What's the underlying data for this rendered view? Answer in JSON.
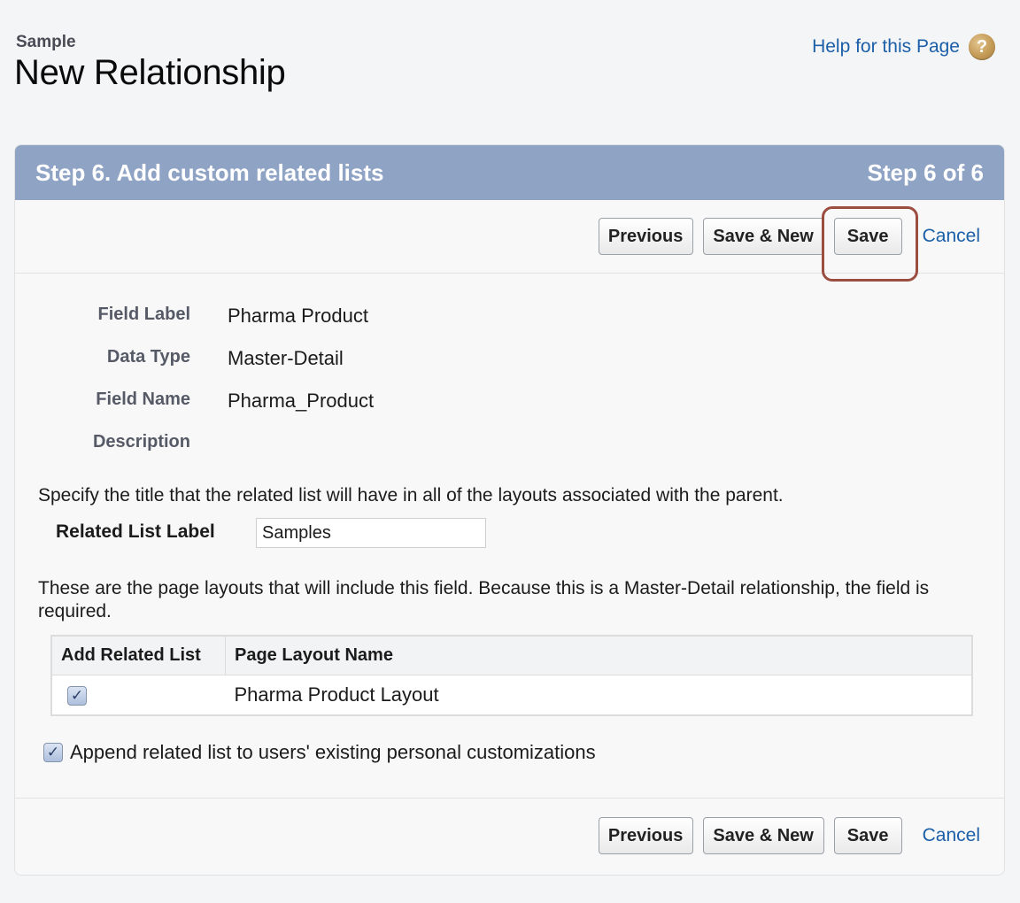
{
  "header": {
    "object_type": "Sample",
    "title": "New Relationship",
    "help_link": "Help for this Page",
    "help_icon_glyph": "?"
  },
  "step_bar": {
    "title": "Step 6. Add custom related lists",
    "progress": "Step 6 of 6"
  },
  "buttons": {
    "previous": "Previous",
    "save_new": "Save & New",
    "save": "Save",
    "cancel": "Cancel"
  },
  "details": [
    {
      "label": "Field Label",
      "value": "Pharma Product"
    },
    {
      "label": "Data Type",
      "value": "Master-Detail"
    },
    {
      "label": "Field Name",
      "value": "Pharma_Product"
    },
    {
      "label": "Description",
      "value": ""
    }
  ],
  "related_list": {
    "instructions": "Specify the title that the related list will have in all of the layouts associated with the parent.",
    "label": "Related List Label",
    "value": "Samples"
  },
  "layouts": {
    "instructions": "These are the page layouts that will include this field. Because this is a Master-Detail relationship, the field is required.",
    "columns": [
      "Add Related List",
      "Page Layout Name"
    ],
    "rows": [
      {
        "checked": true,
        "name": "Pharma Product Layout"
      }
    ]
  },
  "append": {
    "checked": true,
    "label": "Append related list to users' existing personal customizations"
  },
  "colors": {
    "step_bar": "#8fa3c4",
    "link": "#1b5fa8",
    "highlight": "#9b4e40"
  }
}
